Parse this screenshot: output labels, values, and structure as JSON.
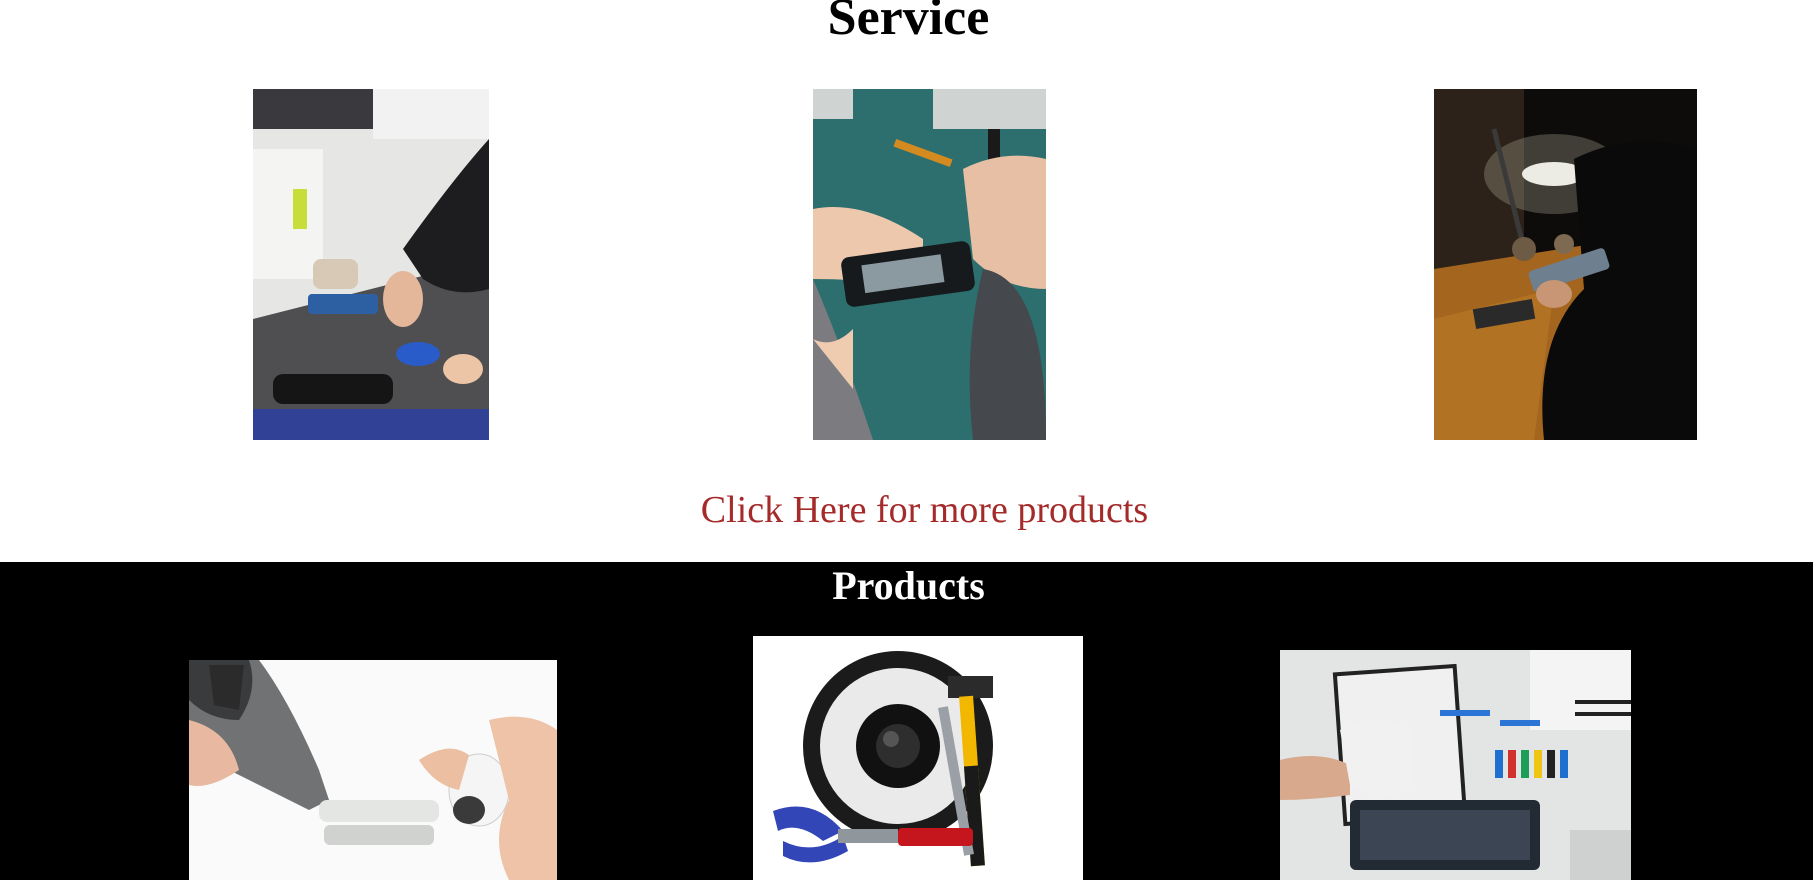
{
  "service": {
    "title": "Service",
    "images": [
      {
        "name": "Technician repairing smartphone with tweezers at store counter"
      },
      {
        "name": "Hands working on phone circuit board on teal mat"
      },
      {
        "name": "Technician repairing phone under desk lamp"
      }
    ]
  },
  "more_link": {
    "label": "Click Here for more products",
    "color": "#a52a2a"
  },
  "products": {
    "title": "Products",
    "images": [
      {
        "name": "Tool repairing wireless earbud"
      },
      {
        "name": "Speaker with pliers, wrench and hammer"
      },
      {
        "name": "Gloved hand repairing tablet with tool set"
      }
    ]
  },
  "colors": {
    "page_background": "#ffffff",
    "products_background": "#000000",
    "title_text": "#000000",
    "products_title_text": "#ffffff"
  }
}
